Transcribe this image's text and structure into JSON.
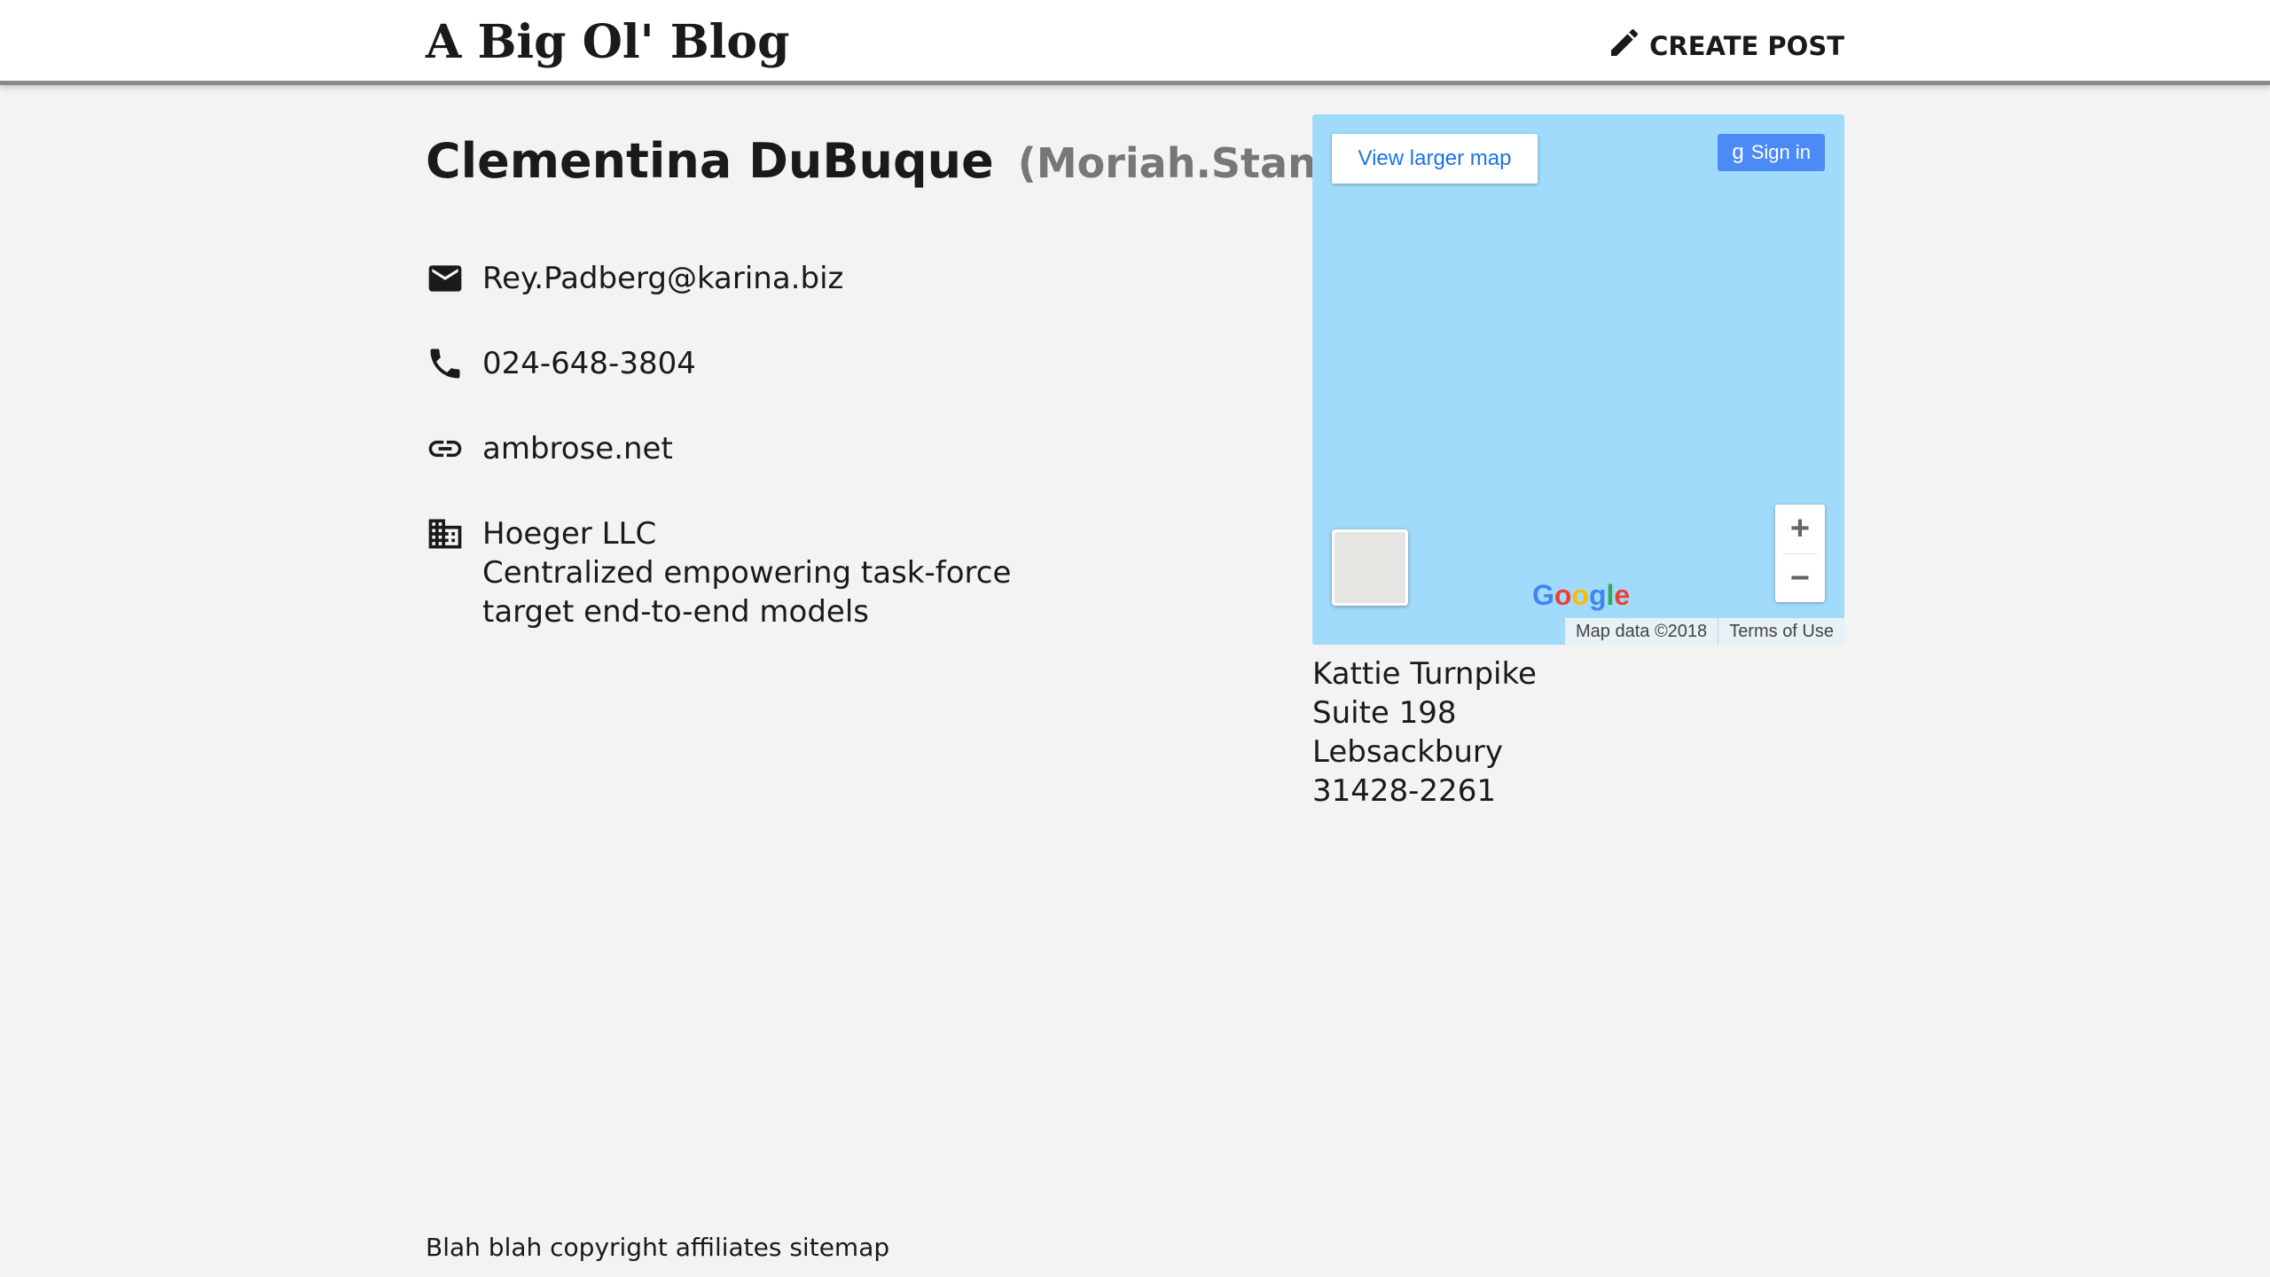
{
  "header": {
    "brand": "A Big Ol' Blog",
    "create_post_label": "CREATE POST"
  },
  "profile": {
    "full_name": "Clementina DuBuque",
    "username": "(Moriah.Stanton)",
    "email": "Rey.Padberg@karina.biz",
    "phone": "024-648-3804",
    "website": "ambrose.net",
    "company": {
      "name": "Hoeger LLC",
      "catch_phrase": "Centralized empowering task-force",
      "bs": "target end-to-end models"
    },
    "address": {
      "street": "Kattie Turnpike",
      "suite": "Suite 198",
      "city": "Lebsackbury",
      "zipcode": "31428-2261"
    }
  },
  "map": {
    "view_larger_label": "View larger map",
    "sign_in_label": "Sign in",
    "zoom_in_label": "+",
    "zoom_out_label": "−",
    "logo_letters": [
      "G",
      "o",
      "o",
      "g",
      "l",
      "e"
    ],
    "logo_colors": [
      "#4285f4",
      "#ea4335",
      "#fbbc05",
      "#4285f4",
      "#34a853",
      "#ea4335"
    ],
    "map_data_label": "Map data ©2018",
    "terms_label": "Terms of Use",
    "water_color": "#a1dbfb"
  },
  "footer": {
    "text": "Blah blah copyright affiliates sitemap"
  }
}
